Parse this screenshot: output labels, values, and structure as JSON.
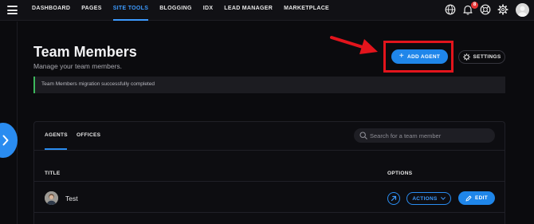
{
  "nav": {
    "items": [
      {
        "label": "DASHBOARD"
      },
      {
        "label": "PAGES"
      },
      {
        "label": "SITE TOOLS"
      },
      {
        "label": "BLOGGING"
      },
      {
        "label": "IDX"
      },
      {
        "label": "LEAD MANAGER"
      },
      {
        "label": "MARKETPLACE"
      }
    ],
    "active": "SITE TOOLS",
    "notification_count": "8",
    "icons": [
      "globe-icon",
      "bell-icon",
      "support-icon",
      "gear-icon",
      "user-avatar"
    ]
  },
  "header": {
    "title": "Team Members",
    "subtitle": "Manage your team members.",
    "add_agent_label": "ADD AGENT",
    "settings_label": "SETTINGS"
  },
  "alert": {
    "message": "Team Members migration successfully completed",
    "status_color": "#3db85c"
  },
  "tabs": [
    {
      "label": "AGENTS"
    },
    {
      "label": "OFFICES"
    }
  ],
  "active_tab": "AGENTS",
  "search": {
    "placeholder": "Search for a team member",
    "value": ""
  },
  "table": {
    "columns": [
      "TITLE",
      "OPTIONS"
    ],
    "rows": [
      {
        "name": "Test",
        "actions_label": "ACTIONS",
        "edit_label": "EDIT"
      }
    ]
  },
  "colors": {
    "accent": "#1f86ea",
    "annotation": "#e3141c",
    "background": "#0b0b0e"
  }
}
